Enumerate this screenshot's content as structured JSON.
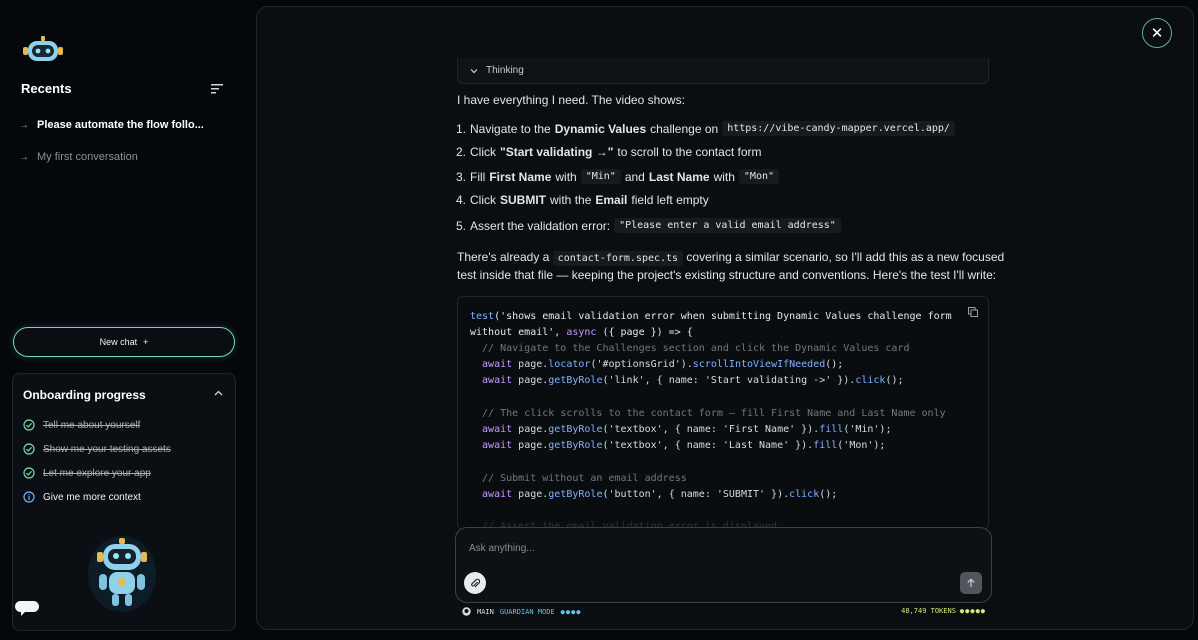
{
  "sidebar": {
    "recents_title": "Recents",
    "recents": [
      {
        "label": "Please automate the flow follo..."
      },
      {
        "label": "My first conversation"
      }
    ],
    "new_chat_label": "New chat",
    "new_chat_plus": "+",
    "onboarding": {
      "title": "Onboarding progress",
      "items": [
        {
          "label": "Tell me about yourself",
          "status": "done"
        },
        {
          "label": "Show me your testing assets",
          "status": "done"
        },
        {
          "label": "Let me explore your app",
          "status": "done"
        },
        {
          "label": "Give me more context",
          "status": "current"
        }
      ]
    }
  },
  "thinking_label": "Thinking",
  "message": {
    "intro": "I have everything I need. The video shows:",
    "steps": [
      {
        "num": "1.",
        "parts": [
          "Navigate to the ",
          "Dynamic Values",
          " challenge on ",
          "https://vibe-candy-mapper.vercel.app/"
        ]
      },
      {
        "num": "2.",
        "parts": [
          "Click ",
          "\"Start validating →\"",
          " to scroll to the contact form"
        ]
      },
      {
        "num": "3.",
        "parts": [
          "Fill ",
          "First Name",
          " with ",
          "\"Min\"",
          " and ",
          "Last Name",
          " with ",
          "\"Mon\""
        ]
      },
      {
        "num": "4.",
        "parts": [
          "Click ",
          "SUBMIT",
          " with the ",
          "Email",
          " field left empty"
        ]
      },
      {
        "num": "5.",
        "parts": [
          "Assert the validation error: ",
          "\"Please enter a valid email address\""
        ]
      }
    ],
    "para_a": "There's already a ",
    "para_code": "contact-form.spec.ts",
    "para_b": " covering a similar scenario, so I'll add this as a new focused",
    "para_line2": "test inside that file — keeping the project's existing structure and conventions. Here's the test I'll write:"
  },
  "code": {
    "l1a": "test",
    "l1b": "('shows email validation error when submitting Dynamic Values challenge form",
    "l2a": "without email', ",
    "l2b": "async",
    "l2c": " ({ page }) => {",
    "l3": "  // Navigate to the Challenges section and click the Dynamic Values card",
    "l4a": "  await",
    "l4b": " page.",
    "l4c": "locator",
    "l4d": "('#optionsGrid').",
    "l4e": "scrollIntoViewIfNeeded",
    "l4f": "();",
    "l5a": "  await",
    "l5b": " page.",
    "l5c": "getByRole",
    "l5d": "('link', { name: 'Start validating ->' }).",
    "l5e": "click",
    "l5f": "();",
    "l6": "  // The click scrolls to the contact form — fill First Name and Last Name only",
    "l7a": "  await",
    "l7b": " page.",
    "l7c": "getByRole",
    "l7d": "('textbox', { name: 'First Name' }).",
    "l7e": "fill",
    "l7f": "('Min');",
    "l8a": "  await",
    "l8b": " page.",
    "l8c": "getByRole",
    "l8d": "('textbox', { name: 'Last Name' }).",
    "l8e": "fill",
    "l8f": "('Mon');",
    "l9": "  // Submit without an email address",
    "l10a": "  await",
    "l10b": " page.",
    "l10c": "getByRole",
    "l10d": "('button', { name: 'SUBMIT' }).",
    "l10e": "click",
    "l10f": "();",
    "l11": "  // Assert the email validation error is displayed"
  },
  "composer": {
    "placeholder": "Ask anything..."
  },
  "status": {
    "branch": "MAIN",
    "mode": "GUARDIAN MODE",
    "mode_dots": "●●●●",
    "tokens": "48,749 TOKENS",
    "token_dots": "●●●●●"
  },
  "colors": {
    "accent_green": "#7ad9a8",
    "mode_blue": "#5fc6e6",
    "tokens_yellow": "#d9e87a"
  }
}
